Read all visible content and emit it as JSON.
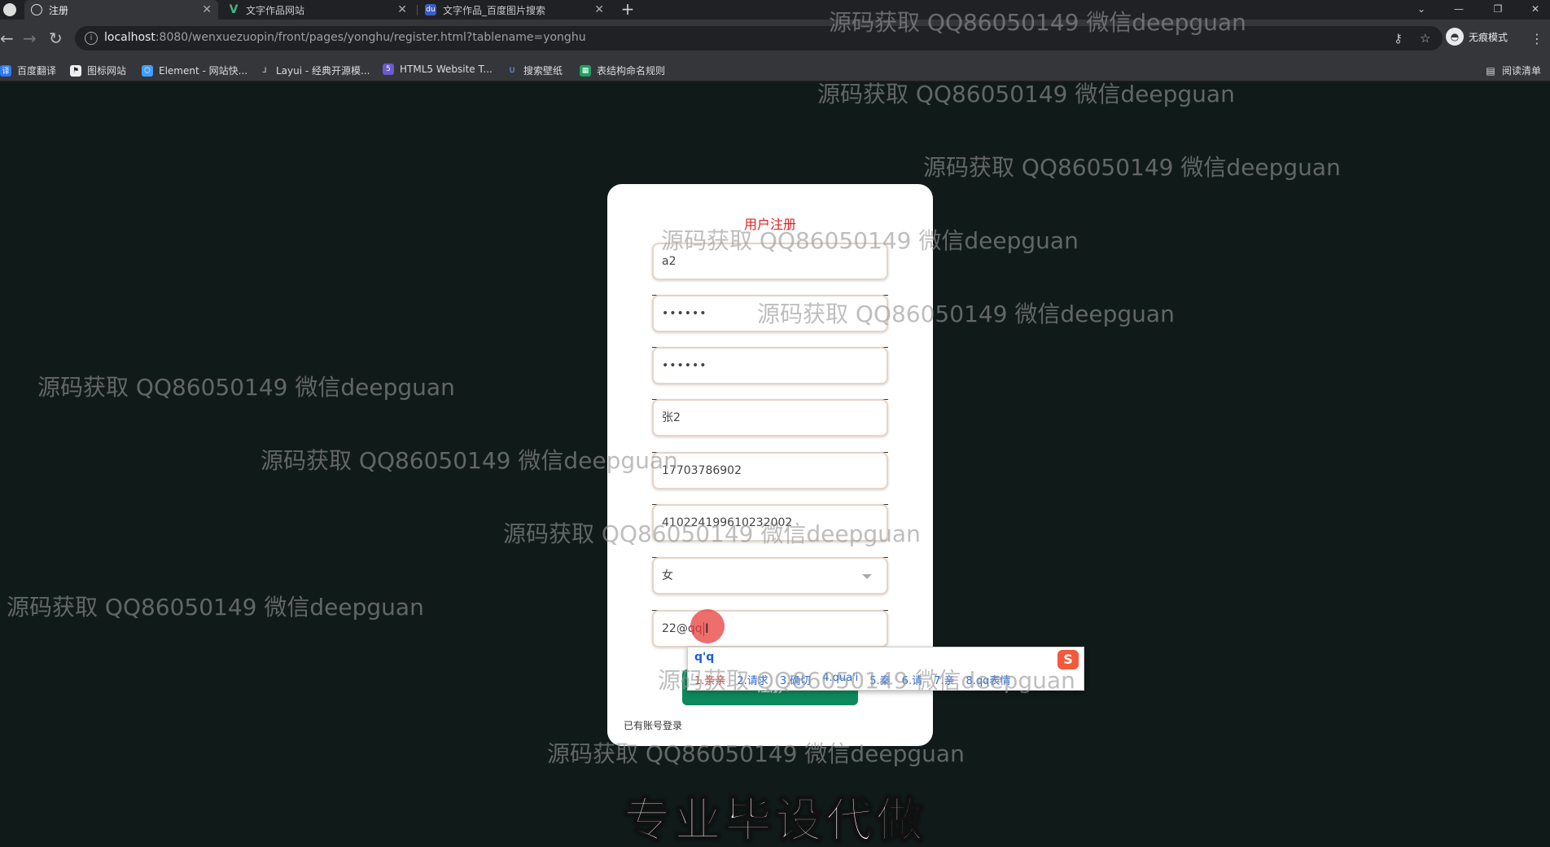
{
  "browser": {
    "tabs": [
      {
        "title": "注册",
        "icon": "globe-icon",
        "active": true
      },
      {
        "title": "文字作品网站",
        "icon": "vue-icon",
        "active": false
      },
      {
        "title": "文字作品_百度图片搜索",
        "icon": "baidu-icon",
        "active": false
      }
    ],
    "url_host": "localhost",
    "url_rest": ":8080/wenxuezuopin/front/pages/yonghu/register.html?tablename=yonghu",
    "incognito_label": "无痕模式",
    "bookmarks": [
      "百度翻译",
      "图标网站",
      "Element - 网站快...",
      "Layui - 经典开源模...",
      "HTML5 Website T...",
      "搜索壁纸",
      "表结构命名规则"
    ],
    "reading_list": "阅读清单"
  },
  "form": {
    "title": "用户注册",
    "username": "a2",
    "password": "••••••",
    "password_confirm": "••••••",
    "name": "张2",
    "phone": "17703786902",
    "id_card": "410224199610232002",
    "gender": "女",
    "email": "22@qq",
    "submit_label": "注册",
    "login_link": "已有账号登录"
  },
  "ime": {
    "composition": "q'q",
    "candidates": [
      "1.亲亲",
      "2.请求",
      "3.确切",
      "4.qua'i",
      "5.秦",
      "6.请",
      "7.亲",
      "8.qq表情"
    ]
  },
  "watermark_text": "源码获取 QQ86050149 微信deepguan",
  "subtitle": "专业毕设代做"
}
